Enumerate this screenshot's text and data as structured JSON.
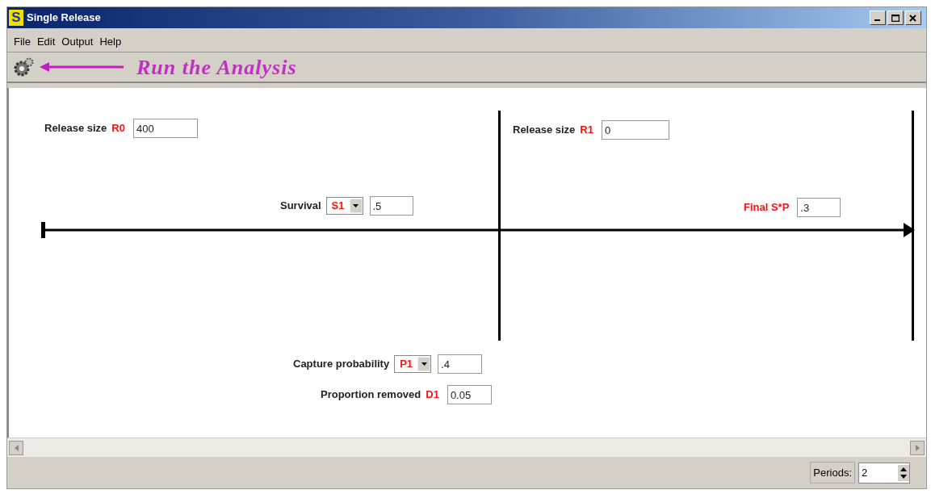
{
  "window": {
    "title": "Single Release",
    "app_letter": "S"
  },
  "menu": [
    "File",
    "Edit",
    "Output",
    "Help"
  ],
  "toolbar": {
    "hint": "Run the Analysis"
  },
  "params": [
    {
      "kind": "input",
      "label": "Release size",
      "code": "R0",
      "value": "400"
    },
    {
      "kind": "input",
      "label": "Release size",
      "code": "R1",
      "value": "0"
    },
    {
      "kind": "select",
      "label": "Survival",
      "code": "S1",
      "value": ".5"
    },
    {
      "kind": "input",
      "code": "Final S*P",
      "value": ".3"
    },
    {
      "kind": "select",
      "label": "Capture probability",
      "code": "P1",
      "value": ".4"
    },
    {
      "kind": "input",
      "label": "Proportion removed",
      "code": "D1",
      "value": "0.05"
    }
  ],
  "status_bar": {
    "periods_label": "Periods:",
    "periods_value": "2"
  }
}
